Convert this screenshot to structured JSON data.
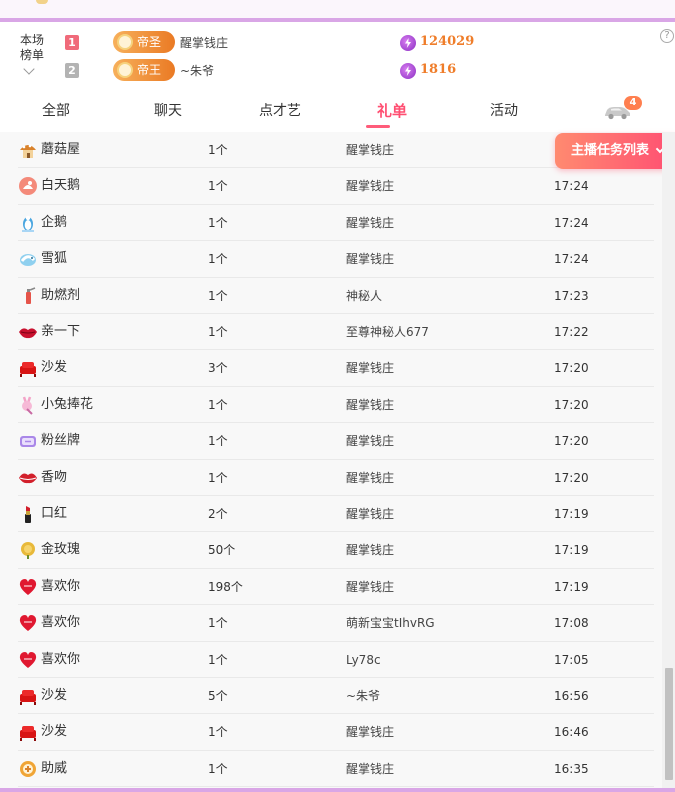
{
  "rank": {
    "title_line1": "本场",
    "title_line2": "榜单",
    "entries": [
      {
        "position": "1",
        "badge": "帝圣",
        "name": "醒掌钱庄",
        "score": "124029"
      },
      {
        "position": "2",
        "badge": "帝王",
        "name": "~朱爷",
        "score": "1816"
      }
    ],
    "help": "?"
  },
  "tabs": [
    {
      "label": "全部"
    },
    {
      "label": "聊天"
    },
    {
      "label": "点才艺"
    },
    {
      "label": "礼单",
      "active": true
    },
    {
      "label": "活动"
    }
  ],
  "car": {
    "badge": "4"
  },
  "task_button": {
    "label": "主播任务列表"
  },
  "gifts": [
    {
      "icon": "mushroom-house-icon",
      "name": "蘑菇屋",
      "count": "1个",
      "sender": "醒掌钱庄",
      "time": ""
    },
    {
      "icon": "white-swan-icon",
      "name": "白天鹅",
      "count": "1个",
      "sender": "醒掌钱庄",
      "time": "17:24"
    },
    {
      "icon": "penguin-icon",
      "name": "企鹅",
      "count": "1个",
      "sender": "醒掌钱庄",
      "time": "17:24"
    },
    {
      "icon": "snow-fox-icon",
      "name": "雪狐",
      "count": "1个",
      "sender": "醒掌钱庄",
      "time": "17:24"
    },
    {
      "icon": "booster-spray-icon",
      "name": "助燃剂",
      "count": "1个",
      "sender": "神秘人",
      "time": "17:23"
    },
    {
      "icon": "kiss-lips-icon",
      "name": "亲一下",
      "count": "1个",
      "sender": "至尊神秘人677",
      "time": "17:22"
    },
    {
      "icon": "sofa-icon",
      "name": "沙发",
      "count": "3个",
      "sender": "醒掌钱庄",
      "time": "17:20"
    },
    {
      "icon": "bunny-bouquet-icon",
      "name": "小兔捧花",
      "count": "1个",
      "sender": "醒掌钱庄",
      "time": "17:20"
    },
    {
      "icon": "fan-badge-icon",
      "name": "粉丝牌",
      "count": "1个",
      "sender": "醒掌钱庄",
      "time": "17:20"
    },
    {
      "icon": "lips-kiss-icon",
      "name": "香吻",
      "count": "1个",
      "sender": "醒掌钱庄",
      "time": "17:20"
    },
    {
      "icon": "lipstick-icon",
      "name": "口红",
      "count": "2个",
      "sender": "醒掌钱庄",
      "time": "17:19"
    },
    {
      "icon": "golden-rose-icon",
      "name": "金玫瑰",
      "count": "50个",
      "sender": "醒掌钱庄",
      "time": "17:19"
    },
    {
      "icon": "heart-love-icon",
      "name": "喜欢你",
      "count": "198个",
      "sender": "醒掌钱庄",
      "time": "17:19"
    },
    {
      "icon": "heart-love-icon",
      "name": "喜欢你",
      "count": "1个",
      "sender": "萌新宝宝tIhvRG",
      "time": "17:08"
    },
    {
      "icon": "heart-love-icon",
      "name": "喜欢你",
      "count": "1个",
      "sender": "Ly78c",
      "time": "17:05"
    },
    {
      "icon": "sofa-icon",
      "name": "沙发",
      "count": "5个",
      "sender": "~朱爷",
      "time": "16:56"
    },
    {
      "icon": "sofa-icon",
      "name": "沙发",
      "count": "1个",
      "sender": "醒掌钱庄",
      "time": "16:46"
    },
    {
      "icon": "cheer-icon",
      "name": "助威",
      "count": "1个",
      "sender": "醒掌钱庄",
      "time": "16:35"
    }
  ],
  "colors": {
    "accent": "#ff4f72",
    "frame": "#d9a6e6",
    "score": "#ef7d2a",
    "badge": "#ea7a24"
  }
}
